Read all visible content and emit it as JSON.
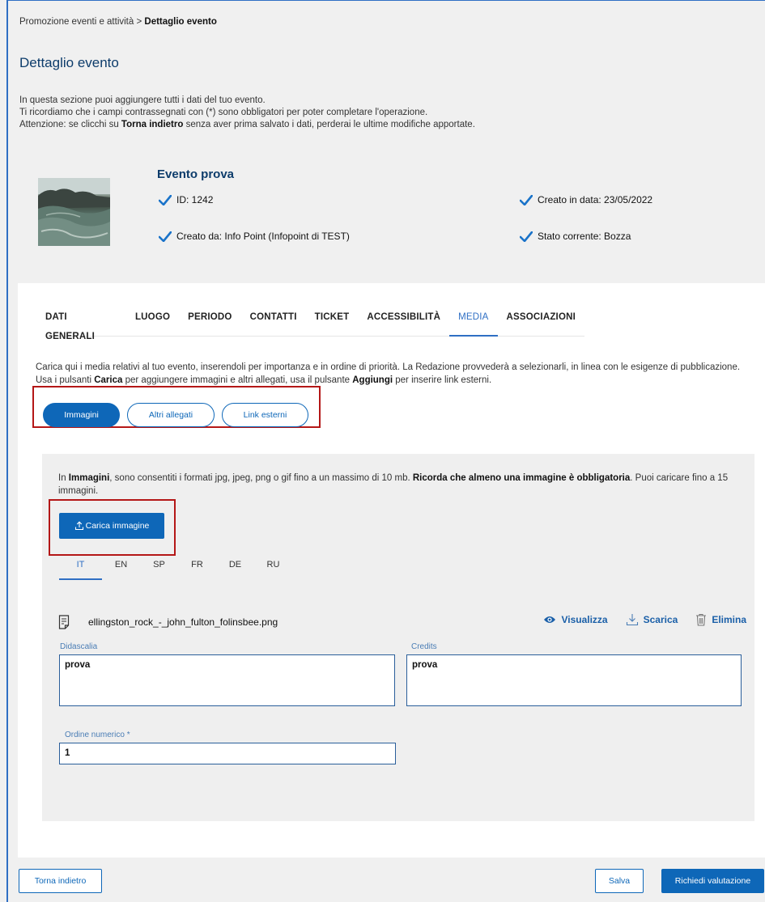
{
  "breadcrumb": {
    "parent": "Promozione eventi e attività",
    "separator": " > ",
    "current": "Dettaglio evento"
  },
  "page_title": "Dettaglio evento",
  "intro": {
    "line1": "In questa sezione puoi aggiungere tutti i dati del tuo evento.",
    "line2": "Ti ricordiamo che i campi contrassegnati con (*) sono obbligatori per poter completare l'operazione.",
    "line3_pre": "Attenzione: se clicchi su ",
    "line3_bold": "Torna indietro",
    "line3_post": " senza aver prima salvato i dati, perderai le ultime modifiche apportate."
  },
  "event": {
    "title": "Evento prova",
    "id_label": "ID: 1242",
    "created_by_label": "Creato da: Info Point (Infopoint di TEST)",
    "created_date_label": "Creato in data: 23/05/2022",
    "status_label": "Stato corrente: Bozza"
  },
  "tabs": [
    {
      "label": "DATI GENERALI"
    },
    {
      "label": "LUOGO"
    },
    {
      "label": "PERIODO"
    },
    {
      "label": "CONTATTI"
    },
    {
      "label": "TICKET"
    },
    {
      "label": "ACCESSIBILITÀ"
    },
    {
      "label": "MEDIA"
    },
    {
      "label": "ASSOCIAZIONI"
    }
  ],
  "active_tab": "MEDIA",
  "media_desc": {
    "p1": "Carica qui i media relativi al tuo evento, inserendoli per importanza e in ordine di priorità. La Redazione provvederà a selezionarli, in linea con le esigenze di pubblicazione. Usa i pulsanti ",
    "b1": "Carica",
    "p2": " per aggiungere immagini e altri allegati, usa il pulsante ",
    "b2": "Aggiungi",
    "p3": " per inserire link esterni."
  },
  "media_types": [
    {
      "label": "Immagini",
      "active": true
    },
    {
      "label": "Altri allegati",
      "active": false
    },
    {
      "label": "Link esterni",
      "active": false
    }
  ],
  "images_desc": {
    "p1": "In ",
    "b1": "Immagini",
    "p2": ", sono consentiti i formati jpg, jpeg, png o gif fino a un massimo di 10 mb. ",
    "b2": "Ricorda che almeno una immagine è obbligatoria",
    "p3": ". Puoi caricare fino a 15 immagini."
  },
  "upload_button": "Carica immagine",
  "languages": [
    "IT",
    "EN",
    "SP",
    "FR",
    "DE",
    "RU"
  ],
  "active_language": "IT",
  "file": {
    "name": "ellingston_rock_-_john_fulton_folinsbee.png",
    "view_label": "Visualizza",
    "download_label": "Scarica",
    "delete_label": "Elimina"
  },
  "fields": {
    "caption_label": "Didascalia",
    "caption_value": "prova",
    "credits_label": "Credits",
    "credits_value": "prova",
    "order_label": "Ordine numerico *",
    "order_value": "1"
  },
  "footer": {
    "back_label": "Torna indietro",
    "save_label": "Salva",
    "submit_label": "Richiedi valutazione"
  },
  "colors": {
    "primary": "#0e67b8",
    "title": "#0d3c6b",
    "highlight_box": "#b41717",
    "check": "#1a73c9"
  }
}
